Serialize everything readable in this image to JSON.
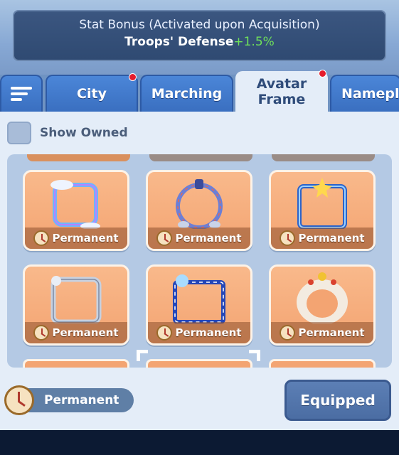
{
  "stat": {
    "title": "Stat Bonus (Activated upon Acquisition)",
    "label": "Troops' Defense",
    "bonus": "+1.5%"
  },
  "tabs": [
    {
      "label": "City",
      "notification": true
    },
    {
      "label": "Marching",
      "notification": false
    },
    {
      "label": "Avatar\nFrame",
      "notification": true,
      "active": true
    },
    {
      "label": "Namepla",
      "notification": false
    }
  ],
  "filter": {
    "show_owned_label": "Show Owned",
    "checked": false
  },
  "frames": [
    {
      "duration": "Permanent",
      "icon": "cloud-rainbow-frame"
    },
    {
      "duration": "Permanent",
      "icon": "lantern-ring-frame"
    },
    {
      "duration": "Permanent",
      "icon": "ice-star-frame"
    },
    {
      "duration": "Permanent",
      "icon": "silver-mech-frame"
    },
    {
      "duration": "Permanent",
      "icon": "blue-festival-frame"
    },
    {
      "duration": "Permanent",
      "icon": "lion-dance-frame"
    }
  ],
  "footer": {
    "duration": "Permanent",
    "equipped_label": "Equipped"
  },
  "colors": {
    "card": "#f3a472",
    "tab": "#3a6fc0",
    "notification": "#e51c2c",
    "bonus": "#6fe05a"
  }
}
